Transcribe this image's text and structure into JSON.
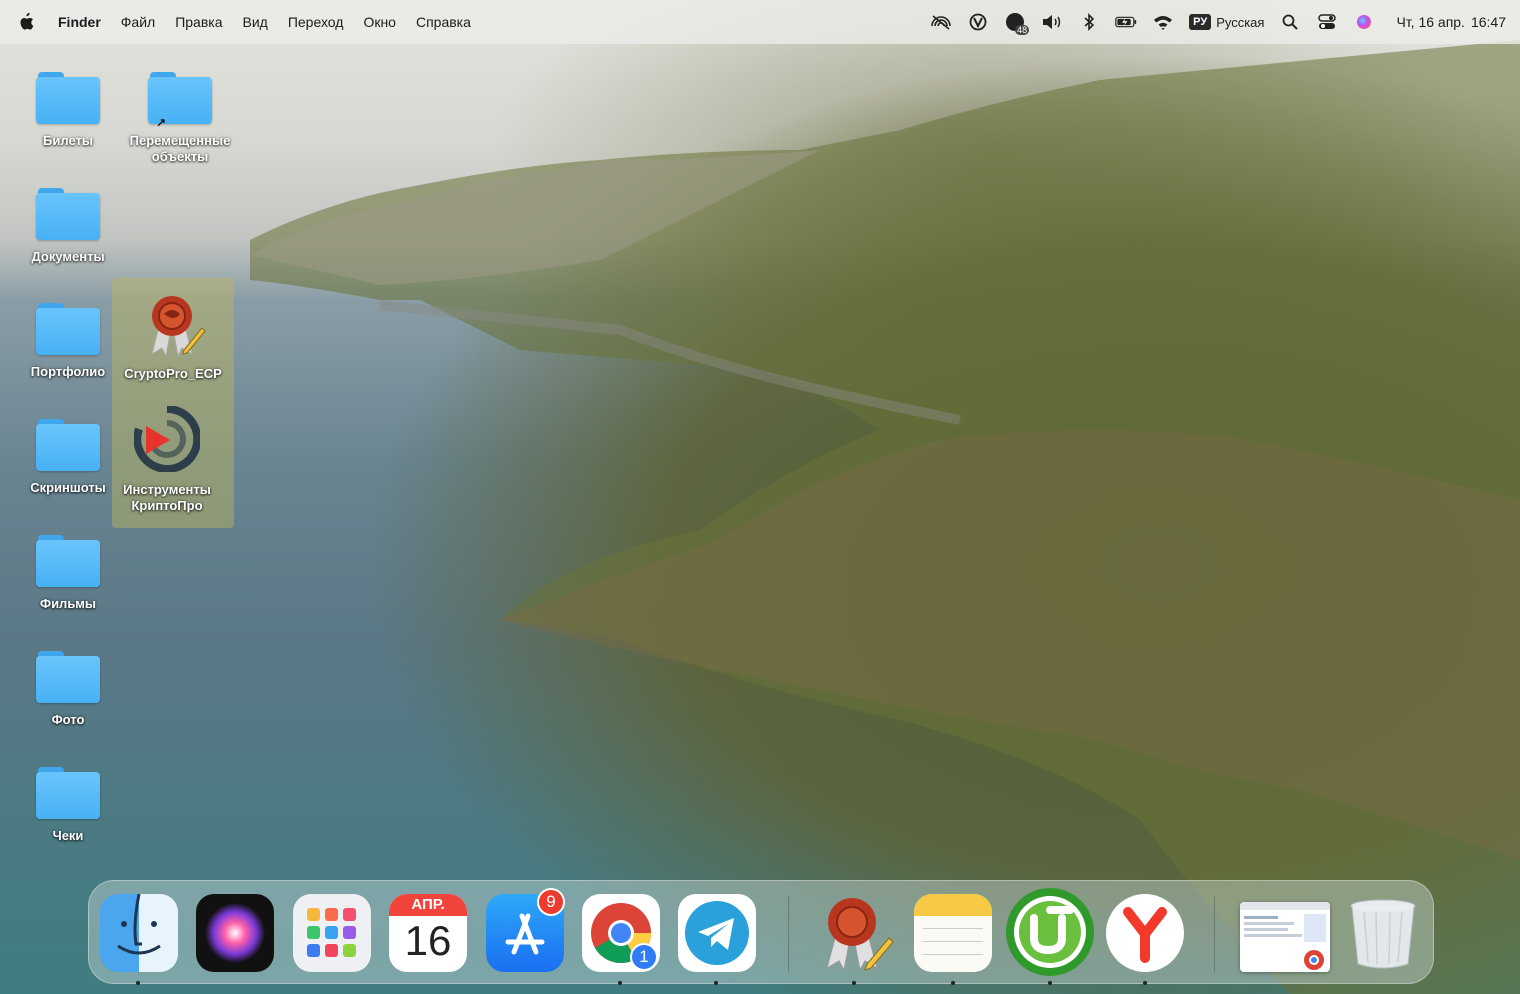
{
  "menubar": {
    "app_name": "Finder",
    "menus": [
      "Файл",
      "Правка",
      "Вид",
      "Переход",
      "Окно",
      "Справка"
    ],
    "status": {
      "badge_number": "48",
      "input_code": "РУ",
      "input_name": "Русская",
      "date": "Чт, 16 апр.",
      "time": "16:47"
    }
  },
  "desktop": {
    "folders": [
      "Билеты",
      "Документы",
      "Портфолио",
      "Скриншоты",
      "Фильмы",
      "Фото",
      "Чеки"
    ],
    "moved": "Перемещенные объекты",
    "apps": [
      "CryptoPro_ECP",
      "Инструменты КриптоПро"
    ]
  },
  "dock": {
    "calendar": {
      "month": "АПР.",
      "day": "16"
    },
    "appstore_badge": "9",
    "chrome_badge": "1",
    "colors": {
      "accent": "#2f7cf6",
      "badge": "#ee3b30"
    }
  }
}
